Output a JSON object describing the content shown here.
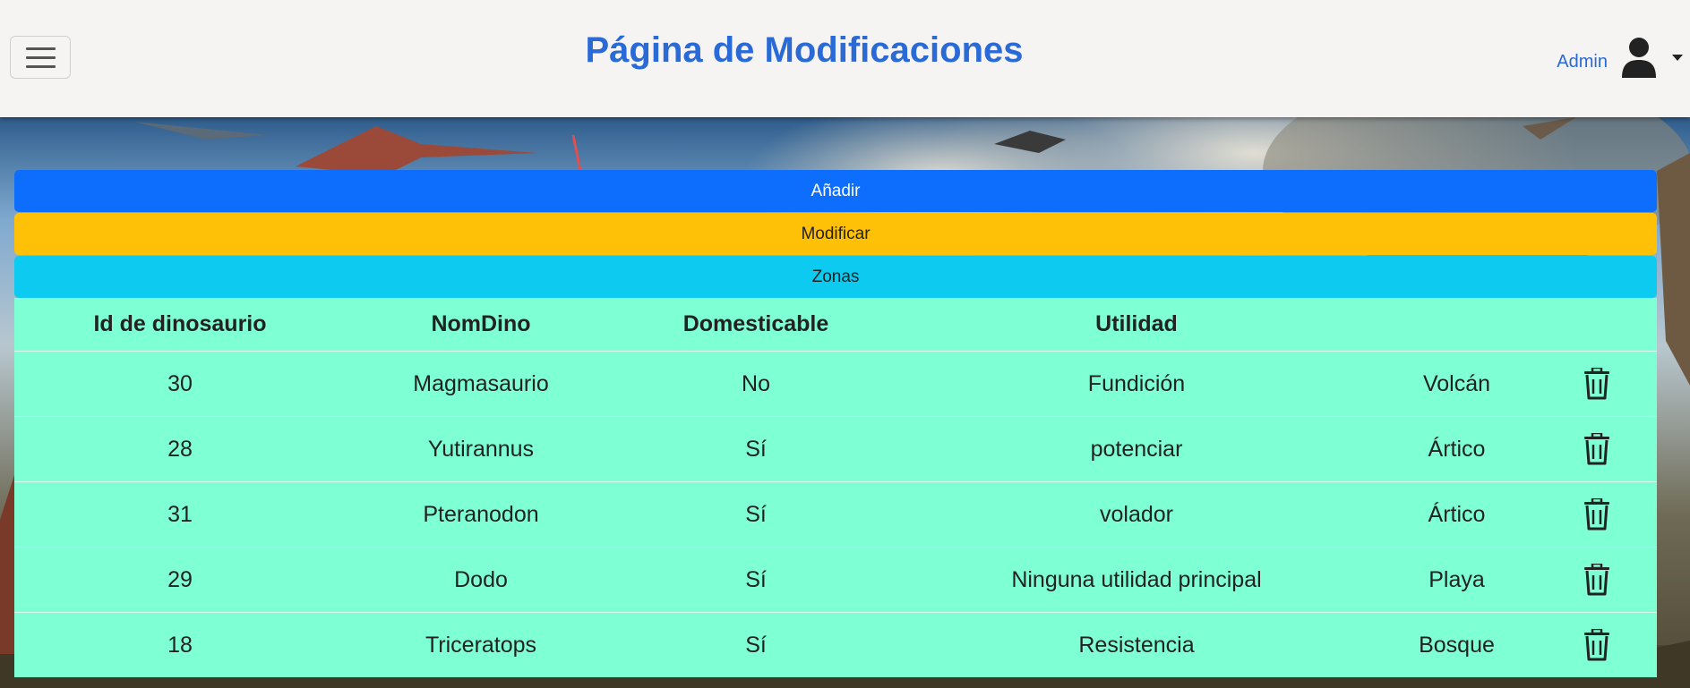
{
  "header": {
    "title": "Página de Modificaciones",
    "user_name": "Admin",
    "menu_icon": "hamburger-icon",
    "user_icon": "user-icon"
  },
  "actions": {
    "add_label": "Añadir",
    "modify_label": "Modificar",
    "zones_label": "Zonas"
  },
  "table": {
    "headers": [
      "Id de dinosaurio",
      "NomDino",
      "Domesticable",
      "Utilidad",
      "",
      ""
    ],
    "rows": [
      {
        "id": "30",
        "name": "Magmasaurio",
        "domesticable": "No",
        "utilidad": "Fundición",
        "zona": "Volcán"
      },
      {
        "id": "28",
        "name": "Yutirannus",
        "domesticable": "Sí",
        "utilidad": "potenciar",
        "zona": "Ártico"
      },
      {
        "id": "31",
        "name": "Pteranodon",
        "domesticable": "Sí",
        "utilidad": "volador",
        "zona": "Ártico"
      },
      {
        "id": "29",
        "name": "Dodo",
        "domesticable": "Sí",
        "utilidad": "Ninguna utilidad principal",
        "zona": "Playa"
      },
      {
        "id": "18",
        "name": "Triceratops",
        "domesticable": "Sí",
        "utilidad": "Resistencia",
        "zona": "Bosque"
      }
    ],
    "delete_icon": "trash-icon"
  },
  "colors": {
    "title": "#2a6ad6",
    "add": "#0d6efd",
    "modify": "#ffc107",
    "zones": "#0dcaf0",
    "table_bg": "#7fffd4"
  }
}
